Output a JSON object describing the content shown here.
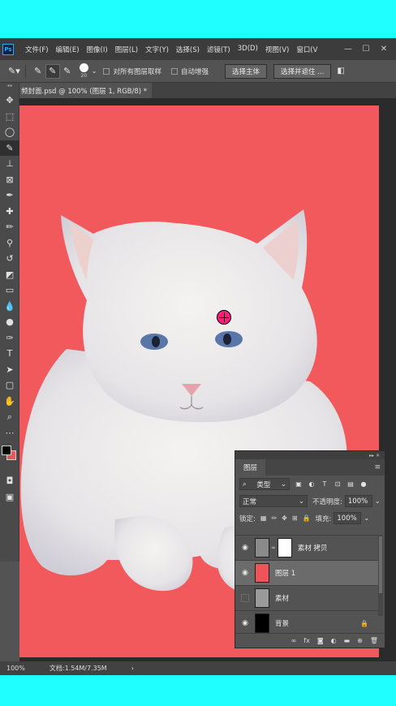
{
  "menu": [
    "文件(F)",
    "编辑(E)",
    "图像(I)",
    "图层(L)",
    "文字(Y)",
    "选择(S)",
    "滤镜(T)",
    "3D(D)",
    "视图(V)",
    "窗口(V"
  ],
  "window_controls": [
    "—",
    "☐",
    "✕"
  ],
  "options": {
    "brush_size": "20",
    "sample_all_layers": "对所有图层取样",
    "auto_enhance": "自动增强",
    "select_subject": "选择主体",
    "select_and_mask": "选择并遮住 ..."
  },
  "document_tab": "频封面.psd @ 100% (图层 1, RGB/8) *",
  "canvas": {
    "background_color": "#f1595d",
    "cursor_color": "#ff1f7d"
  },
  "colors": {
    "foreground": "#000000",
    "background": "#ee5458"
  },
  "status": {
    "zoom": "100%",
    "doc_info": "文档:1.54M/7.35M"
  },
  "layers_panel": {
    "title": "图层",
    "filter_label": "类型",
    "blend_mode": "正常",
    "opacity_label": "不透明度:",
    "opacity": "100%",
    "lock_label": "锁定:",
    "fill_label": "填充:",
    "fill": "100%",
    "layers": [
      {
        "name": "素材 拷贝",
        "visible": true,
        "selected": false
      },
      {
        "name": "图层 1",
        "visible": true,
        "selected": true
      },
      {
        "name": "素材",
        "visible": false,
        "selected": false
      },
      {
        "name": "背景",
        "visible": true,
        "selected": false
      }
    ]
  }
}
